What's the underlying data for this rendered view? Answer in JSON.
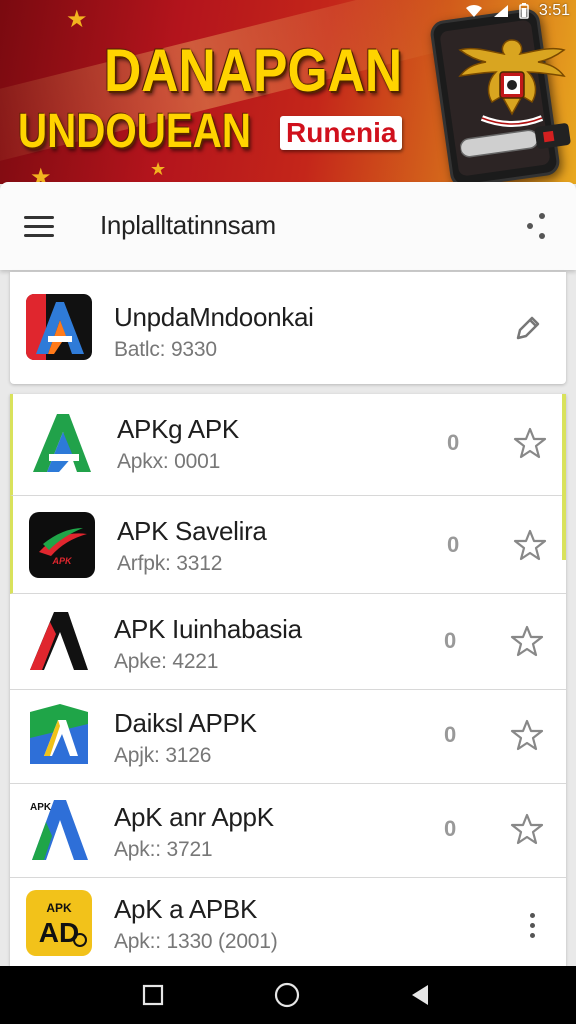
{
  "status_bar": {
    "time": "3:51"
  },
  "banner": {
    "title": "DANAPGAN",
    "subtitle": "UNDOUEAN",
    "tag": "Runenia"
  },
  "app_bar": {
    "title": "Inplalltatinnsam"
  },
  "top_item": {
    "name": "UnpdaMndoonkai",
    "meta": "Batlc: 9330"
  },
  "items": [
    {
      "name": "APKg APK",
      "meta": "Apkx: 0001",
      "count": "0",
      "icon": "apk-a-icon-green-blue"
    },
    {
      "name": "APK Savelira",
      "meta": "Arfpk: 3312",
      "count": "0",
      "icon": "apk-swoosh-icon"
    },
    {
      "name": "APK Iuinhabasia",
      "meta": "Apke: 4221",
      "count": "0",
      "icon": "apk-a-icon-red-black"
    },
    {
      "name": "Daiksl APPK",
      "meta": "Apjk: 3126",
      "count": "0",
      "icon": "apk-a-icon-green-shield"
    },
    {
      "name": "ApK anr AppK",
      "meta": "Apk:: 3721",
      "count": "0",
      "icon": "apk-a-icon-blue-apk"
    },
    {
      "name": "ApK a APBK",
      "meta": "Apk:: 1330  (2001)",
      "count": "",
      "icon": "apk-ad-icon-yellow"
    }
  ],
  "icons": {
    "menu": "hamburger-icon",
    "share": "share-icon",
    "edit": "edit-icon",
    "star": "star-icon",
    "more": "more-vert-icon",
    "nav_recents": "square-icon",
    "nav_home": "circle-icon",
    "nav_back": "triangle-back-icon"
  },
  "colors": {
    "banner_red": "#b3141c",
    "banner_gold": "#ffd400",
    "highlight": "#d9e25c",
    "nav_bg": "#000000"
  }
}
